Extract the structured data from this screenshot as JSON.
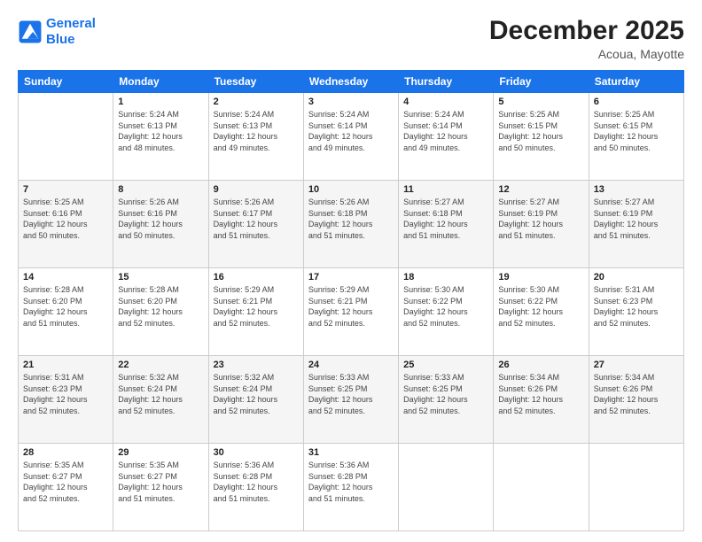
{
  "header": {
    "logo_line1": "General",
    "logo_line2": "Blue",
    "month": "December 2025",
    "location": "Acoua, Mayotte"
  },
  "days_of_week": [
    "Sunday",
    "Monday",
    "Tuesday",
    "Wednesday",
    "Thursday",
    "Friday",
    "Saturday"
  ],
  "weeks": [
    [
      {
        "num": "",
        "info": ""
      },
      {
        "num": "1",
        "info": "Sunrise: 5:24 AM\nSunset: 6:13 PM\nDaylight: 12 hours\nand 48 minutes."
      },
      {
        "num": "2",
        "info": "Sunrise: 5:24 AM\nSunset: 6:13 PM\nDaylight: 12 hours\nand 49 minutes."
      },
      {
        "num": "3",
        "info": "Sunrise: 5:24 AM\nSunset: 6:14 PM\nDaylight: 12 hours\nand 49 minutes."
      },
      {
        "num": "4",
        "info": "Sunrise: 5:24 AM\nSunset: 6:14 PM\nDaylight: 12 hours\nand 49 minutes."
      },
      {
        "num": "5",
        "info": "Sunrise: 5:25 AM\nSunset: 6:15 PM\nDaylight: 12 hours\nand 50 minutes."
      },
      {
        "num": "6",
        "info": "Sunrise: 5:25 AM\nSunset: 6:15 PM\nDaylight: 12 hours\nand 50 minutes."
      }
    ],
    [
      {
        "num": "7",
        "info": "Sunrise: 5:25 AM\nSunset: 6:16 PM\nDaylight: 12 hours\nand 50 minutes."
      },
      {
        "num": "8",
        "info": "Sunrise: 5:26 AM\nSunset: 6:16 PM\nDaylight: 12 hours\nand 50 minutes."
      },
      {
        "num": "9",
        "info": "Sunrise: 5:26 AM\nSunset: 6:17 PM\nDaylight: 12 hours\nand 51 minutes."
      },
      {
        "num": "10",
        "info": "Sunrise: 5:26 AM\nSunset: 6:18 PM\nDaylight: 12 hours\nand 51 minutes."
      },
      {
        "num": "11",
        "info": "Sunrise: 5:27 AM\nSunset: 6:18 PM\nDaylight: 12 hours\nand 51 minutes."
      },
      {
        "num": "12",
        "info": "Sunrise: 5:27 AM\nSunset: 6:19 PM\nDaylight: 12 hours\nand 51 minutes."
      },
      {
        "num": "13",
        "info": "Sunrise: 5:27 AM\nSunset: 6:19 PM\nDaylight: 12 hours\nand 51 minutes."
      }
    ],
    [
      {
        "num": "14",
        "info": "Sunrise: 5:28 AM\nSunset: 6:20 PM\nDaylight: 12 hours\nand 51 minutes."
      },
      {
        "num": "15",
        "info": "Sunrise: 5:28 AM\nSunset: 6:20 PM\nDaylight: 12 hours\nand 52 minutes."
      },
      {
        "num": "16",
        "info": "Sunrise: 5:29 AM\nSunset: 6:21 PM\nDaylight: 12 hours\nand 52 minutes."
      },
      {
        "num": "17",
        "info": "Sunrise: 5:29 AM\nSunset: 6:21 PM\nDaylight: 12 hours\nand 52 minutes."
      },
      {
        "num": "18",
        "info": "Sunrise: 5:30 AM\nSunset: 6:22 PM\nDaylight: 12 hours\nand 52 minutes."
      },
      {
        "num": "19",
        "info": "Sunrise: 5:30 AM\nSunset: 6:22 PM\nDaylight: 12 hours\nand 52 minutes."
      },
      {
        "num": "20",
        "info": "Sunrise: 5:31 AM\nSunset: 6:23 PM\nDaylight: 12 hours\nand 52 minutes."
      }
    ],
    [
      {
        "num": "21",
        "info": "Sunrise: 5:31 AM\nSunset: 6:23 PM\nDaylight: 12 hours\nand 52 minutes."
      },
      {
        "num": "22",
        "info": "Sunrise: 5:32 AM\nSunset: 6:24 PM\nDaylight: 12 hours\nand 52 minutes."
      },
      {
        "num": "23",
        "info": "Sunrise: 5:32 AM\nSunset: 6:24 PM\nDaylight: 12 hours\nand 52 minutes."
      },
      {
        "num": "24",
        "info": "Sunrise: 5:33 AM\nSunset: 6:25 PM\nDaylight: 12 hours\nand 52 minutes."
      },
      {
        "num": "25",
        "info": "Sunrise: 5:33 AM\nSunset: 6:25 PM\nDaylight: 12 hours\nand 52 minutes."
      },
      {
        "num": "26",
        "info": "Sunrise: 5:34 AM\nSunset: 6:26 PM\nDaylight: 12 hours\nand 52 minutes."
      },
      {
        "num": "27",
        "info": "Sunrise: 5:34 AM\nSunset: 6:26 PM\nDaylight: 12 hours\nand 52 minutes."
      }
    ],
    [
      {
        "num": "28",
        "info": "Sunrise: 5:35 AM\nSunset: 6:27 PM\nDaylight: 12 hours\nand 52 minutes."
      },
      {
        "num": "29",
        "info": "Sunrise: 5:35 AM\nSunset: 6:27 PM\nDaylight: 12 hours\nand 51 minutes."
      },
      {
        "num": "30",
        "info": "Sunrise: 5:36 AM\nSunset: 6:28 PM\nDaylight: 12 hours\nand 51 minutes."
      },
      {
        "num": "31",
        "info": "Sunrise: 5:36 AM\nSunset: 6:28 PM\nDaylight: 12 hours\nand 51 minutes."
      },
      {
        "num": "",
        "info": ""
      },
      {
        "num": "",
        "info": ""
      },
      {
        "num": "",
        "info": ""
      }
    ]
  ]
}
